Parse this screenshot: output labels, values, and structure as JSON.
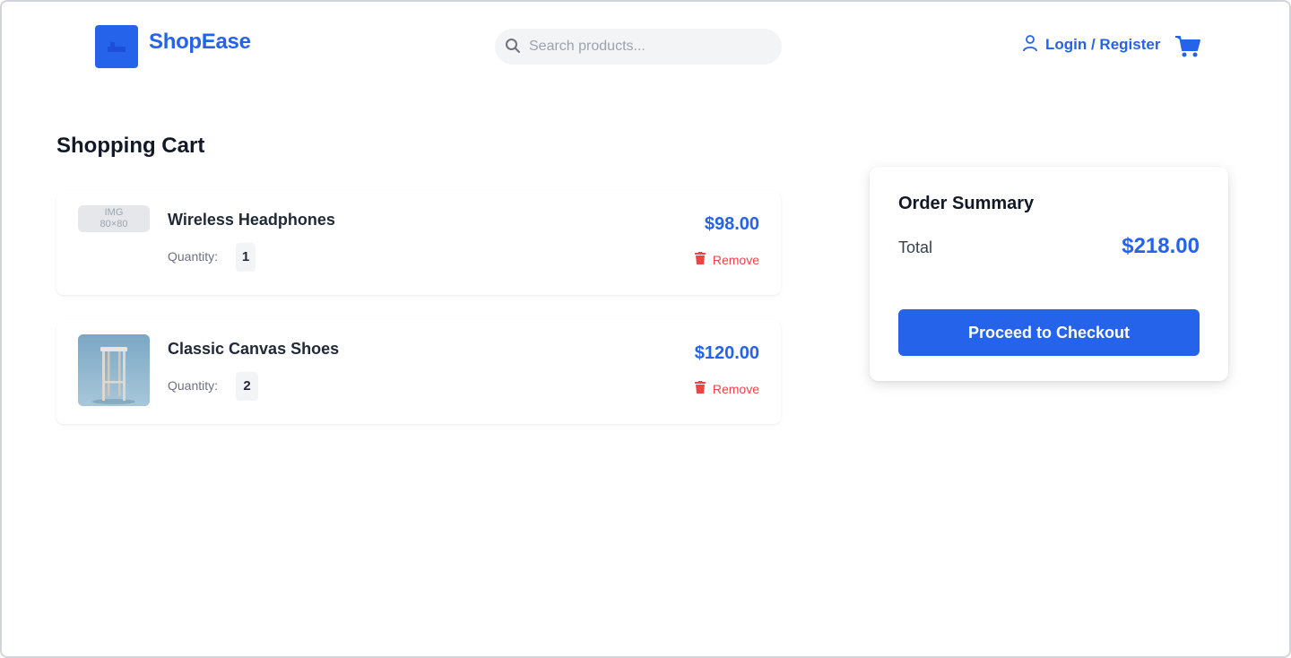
{
  "header": {
    "brand": "ShopEase",
    "search": {
      "placeholder": "Search products...",
      "value": ""
    },
    "login_label": "Login / Register",
    "icons": [
      "logo-icon",
      "search-icon",
      "user-icon",
      "cart-icon"
    ]
  },
  "page": {
    "title": "Shopping Cart"
  },
  "cart": {
    "quantity_label": "Quantity:",
    "remove_label": "Remove",
    "items": [
      {
        "name": "Wireless Headphones",
        "quantity": "1",
        "price": "$98.00",
        "image_placeholder": [
          "IMG",
          "80×80"
        ]
      },
      {
        "name": "Classic Canvas Shoes",
        "quantity": "2",
        "price": "$120.00"
      }
    ]
  },
  "summary": {
    "title": "Order Summary",
    "total_label": "Total",
    "total_value": "$218.00",
    "checkout_label": "Proceed to Checkout"
  },
  "colors": {
    "brand": "#2563eb",
    "danger": "#ef4444",
    "text": "#1f2937"
  }
}
